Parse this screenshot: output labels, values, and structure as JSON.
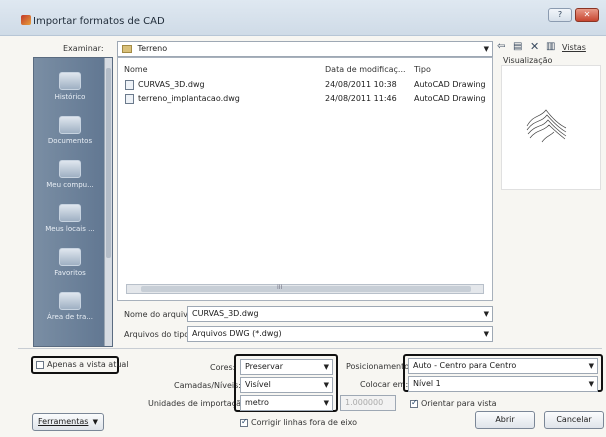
{
  "window": {
    "title": "Importar formatos de CAD",
    "help_label": "?",
    "close_label": "✕"
  },
  "toolbar": {
    "look_in_label": "Examinar:",
    "look_in_value": "Terreno",
    "views_label": "Vistas",
    "back_icon": "back-arrow-icon",
    "delete_icon": "delete-icon"
  },
  "sidebar": {
    "items": [
      {
        "label": "Histórico",
        "icon": "history-icon"
      },
      {
        "label": "Documentos",
        "icon": "documents-icon"
      },
      {
        "label": "Meu compu...",
        "icon": "computer-icon"
      },
      {
        "label": "Meus locais ...",
        "icon": "network-places-icon"
      },
      {
        "label": "Favoritos",
        "icon": "favorites-icon"
      },
      {
        "label": "Área de tra...",
        "icon": "desktop-icon"
      }
    ]
  },
  "file_list": {
    "headers": {
      "name": "Nome",
      "date": "Data de modificaç...",
      "type": "Tipo"
    },
    "rows": [
      {
        "name": "CURVAS_3D.dwg",
        "date": "24/08/2011 10:38",
        "type": "AutoCAD Drawing"
      },
      {
        "name": "terreno_implantacao.dwg",
        "date": "24/08/2011 11:46",
        "type": "AutoCAD Drawing"
      }
    ],
    "scroll_marker": "III"
  },
  "preview": {
    "label": "Visualização"
  },
  "file_fields": {
    "filename_label": "Nome do arquivo:",
    "filename_value": "CURVAS_3D.dwg",
    "filetype_label": "Arquivos do tipo:",
    "filetype_value": "Arquivos DWG  (*.dwg)"
  },
  "options": {
    "current_view_label": "Apenas a vista atual",
    "colors_label": "Cores:",
    "colors_value": "Preservar",
    "layers_label": "Camadas/Níveis:",
    "layers_value": "Visível",
    "units_label": "Unidades de importação:",
    "units_value": "metro",
    "scale_value": "1.000000",
    "positioning_label": "Posicionamento:",
    "positioning_value": "Auto - Centro para Centro",
    "place_at_label": "Colocar em:",
    "place_at_value": "Nível 1",
    "orient_label": "Orientar para vista",
    "correct_lines_label": "Corrigir linhas fora de eixo"
  },
  "buttons": {
    "tools_label": "Ferramentas",
    "open_label": "Abrir",
    "cancel_label": "Cancelar"
  }
}
